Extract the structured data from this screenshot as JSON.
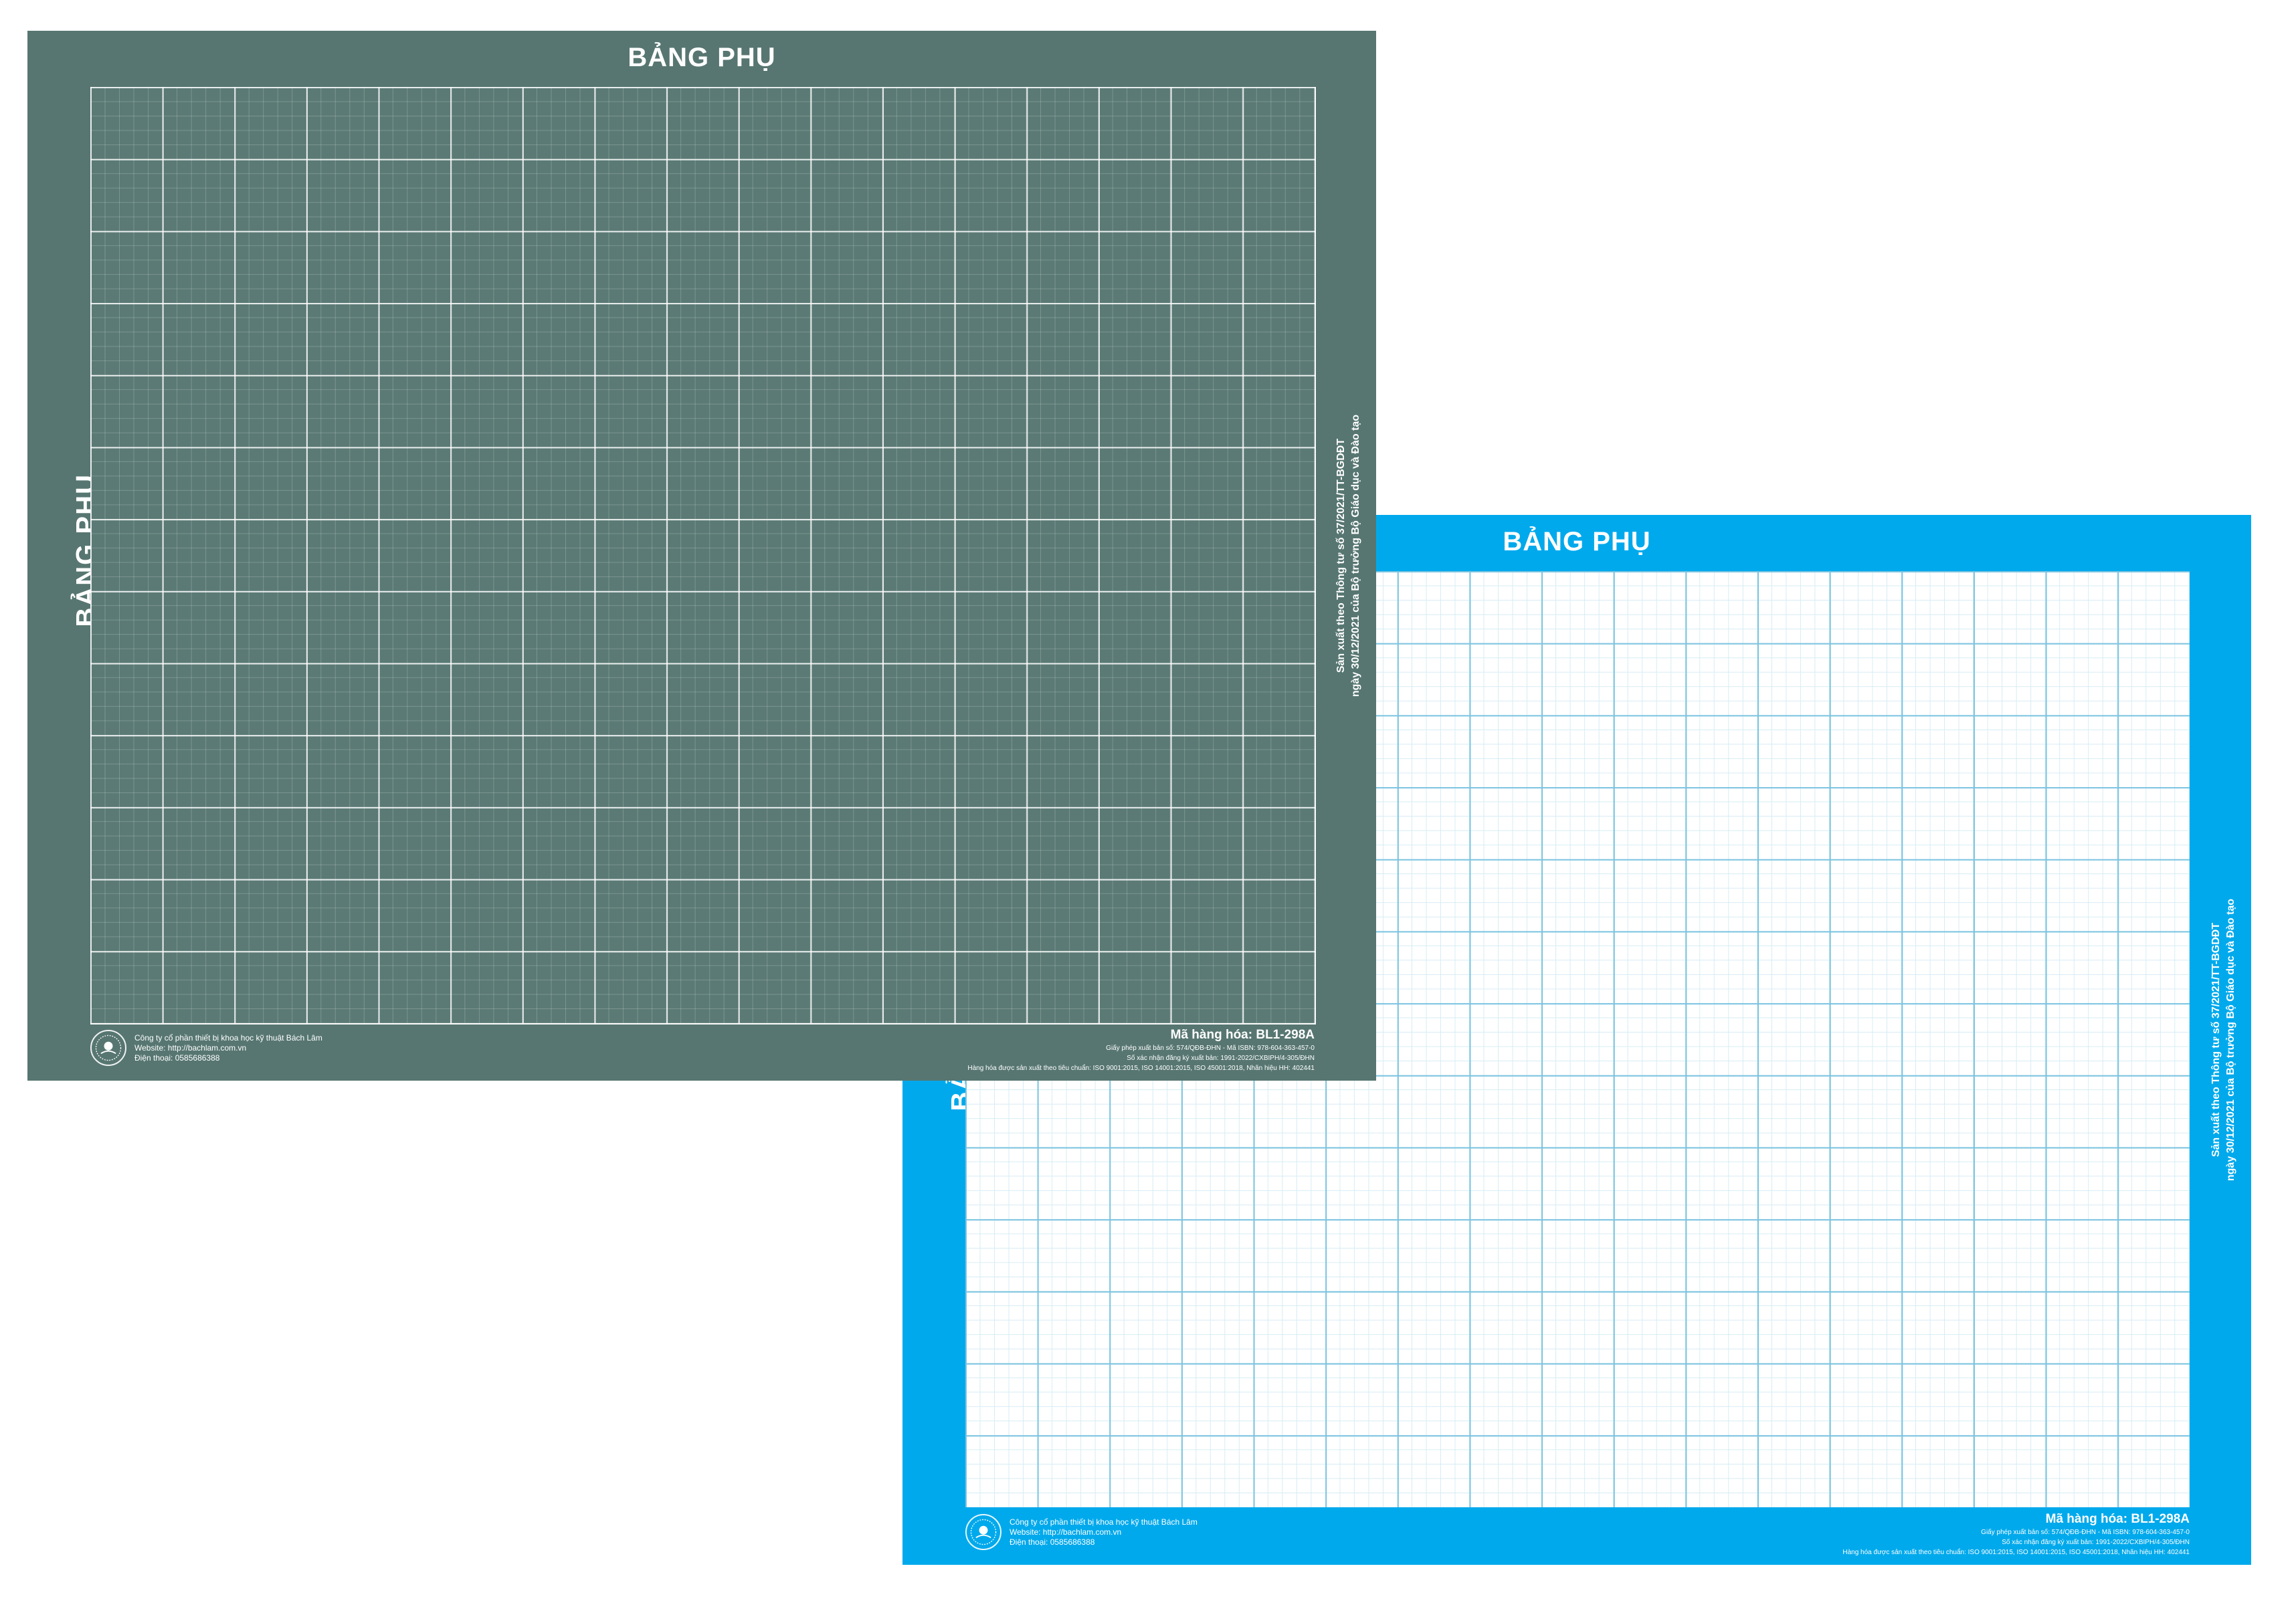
{
  "boards": {
    "green": {
      "title": "BẢNG PHỤ",
      "side_title": "BẢNG PHỤ",
      "regulation_line1": "Sản xuất theo Thông tư số 37/2021/TT-BGDĐT",
      "regulation_line2": "ngày 30/12/2021 của Bộ trưởng Bộ Giáo dục và Đào tạo",
      "company": {
        "name": "Công ty cổ phần thiết bị khoa học kỹ thuật Bách Lâm",
        "website": "Website: http://bachlam.com.vn",
        "phone": "Điện thoại: 0585686388"
      },
      "product": {
        "code": "Mã hàng hóa: BL1-298A",
        "license": "Giấy phép xuất bản số: 574/QĐB-ĐHN  -  Mã ISBN: 978-604-363-457-0",
        "registration": "Số xác nhận đăng ký xuất bản: 1991-2022/CXBIPH/4-305/ĐHN",
        "standards": "Hàng hóa được sản xuất theo tiêu chuẩn: ISO 9001:2015, ISO 14001:2015, ISO 45001:2018, Nhãn hiệu HH: 402441"
      }
    },
    "blue": {
      "title": "BẢNG PHỤ",
      "side_title": "BẢNG PHỤ",
      "regulation_line1": "Sản xuất theo Thông tư số 37/2021/TT-BGDĐT",
      "regulation_line2": "ngày 30/12/2021 của Bộ trưởng Bộ Giáo dục và Đào tạo",
      "company": {
        "name": "Công ty cổ phần thiết bị khoa học kỹ thuật Bách Lâm",
        "website": "Website: http://bachlam.com.vn",
        "phone": "Điện thoại: 0585686388"
      },
      "product": {
        "code": "Mã hàng hóa: BL1-298A",
        "license": "Giấy phép xuất bản số: 574/QĐB-ĐHN  -  Mã ISBN: 978-604-363-457-0",
        "registration": "Số xác nhận đăng ký xuất bản: 1991-2022/CXBIPH/4-305/ĐHN",
        "standards": "Hàng hóa được sản xuất theo tiêu chuẩn: ISO 9001:2015, ISO 14001:2015, ISO 45001:2018, Nhãn hiệu HH: 402441"
      }
    }
  },
  "colors": {
    "green_board": "#577671",
    "blue_board": "#00a9ec",
    "grid_white": "#ffffff"
  },
  "icons": {
    "logo": "company-seal-icon"
  }
}
